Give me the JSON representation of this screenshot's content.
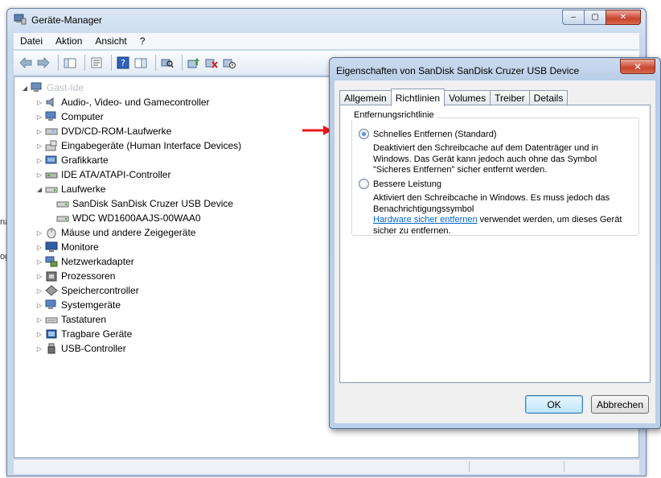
{
  "background_edge_texts": [
    "na",
    "og"
  ],
  "device_manager": {
    "title": "Geräte-Manager",
    "caption_buttons": [
      "–",
      "▢",
      "✕"
    ],
    "menu": [
      "Datei",
      "Aktion",
      "Ansicht",
      "?"
    ],
    "tree": {
      "root_label": "Gast-Ide",
      "items": [
        {
          "label": "Audio-, Video- und Gamecontroller",
          "icon": "speaker-icon",
          "expanded": false
        },
        {
          "label": "Computer",
          "icon": "computer-icon",
          "expanded": false
        },
        {
          "label": "DVD/CD-ROM-Laufwerke",
          "icon": "dvd-drive-icon",
          "expanded": false
        },
        {
          "label": "Eingabegeräte (Human Interface Devices)",
          "icon": "hid-icon",
          "expanded": false
        },
        {
          "label": "Grafikkarte",
          "icon": "display-adapter-icon",
          "expanded": false
        },
        {
          "label": "IDE ATA/ATAPI-Controller",
          "icon": "ide-controller-icon",
          "expanded": false
        },
        {
          "label": "Laufwerke",
          "icon": "disk-drive-icon",
          "expanded": true
        },
        {
          "label": "SanDisk SanDisk Cruzer USB Device",
          "icon": "disk-drive-icon",
          "child": true
        },
        {
          "label": "WDC WD1600AAJS-00WAA0",
          "icon": "disk-drive-icon",
          "child": true
        },
        {
          "label": "Mäuse und andere Zeigegeräte",
          "icon": "mouse-icon",
          "expanded": false
        },
        {
          "label": "Monitore",
          "icon": "monitor-icon",
          "expanded": false
        },
        {
          "label": "Netzwerkadapter",
          "icon": "network-adapter-icon",
          "expanded": false
        },
        {
          "label": "Prozessoren",
          "icon": "processor-icon",
          "expanded": false
        },
        {
          "label": "Speichercontroller",
          "icon": "storage-controller-icon",
          "expanded": false
        },
        {
          "label": "Systemgeräte",
          "icon": "system-device-icon",
          "expanded": false
        },
        {
          "label": "Tastaturen",
          "icon": "keyboard-icon",
          "expanded": false
        },
        {
          "label": "Tragbare Geräte",
          "icon": "portable-device-icon",
          "expanded": false
        },
        {
          "label": "USB-Controller",
          "icon": "usb-icon",
          "expanded": false
        }
      ]
    }
  },
  "properties_dialog": {
    "title": "Eigenschaften von SanDisk SanDisk Cruzer USB Device",
    "close_label": "✕",
    "tabs": [
      "Allgemein",
      "Richtlinien",
      "Volumes",
      "Treiber",
      "Details"
    ],
    "active_tab": "Richtlinien",
    "group_title": "Entfernungsrichtlinie",
    "option_quick": {
      "label": "Schnelles Entfernen (Standard)",
      "checked": true,
      "desc": [
        "Deaktiviert den Schreibcache auf dem Datenträger und in",
        "Windows. Das Gerät kann jedoch auch ohne das Symbol",
        "\"Sicheres Entfernen\" sicher entfernt werden."
      ]
    },
    "option_performance": {
      "label": "Bessere Leistung",
      "checked": false,
      "desc_lines": [
        "Aktiviert den Schreibcache in Windows. Es muss jedoch das",
        "Benachrichtigungssymbol"
      ],
      "link_text": "Hardware sicher entfernen",
      "after_link": " verwendet werden, um dieses Gerät",
      "last_line": "sicher zu entfernen."
    },
    "ok_label": "OK",
    "cancel_label": "Abbrechen"
  },
  "colors": {
    "annotation_arrow": "#e8191a",
    "link": "#0066cc"
  }
}
